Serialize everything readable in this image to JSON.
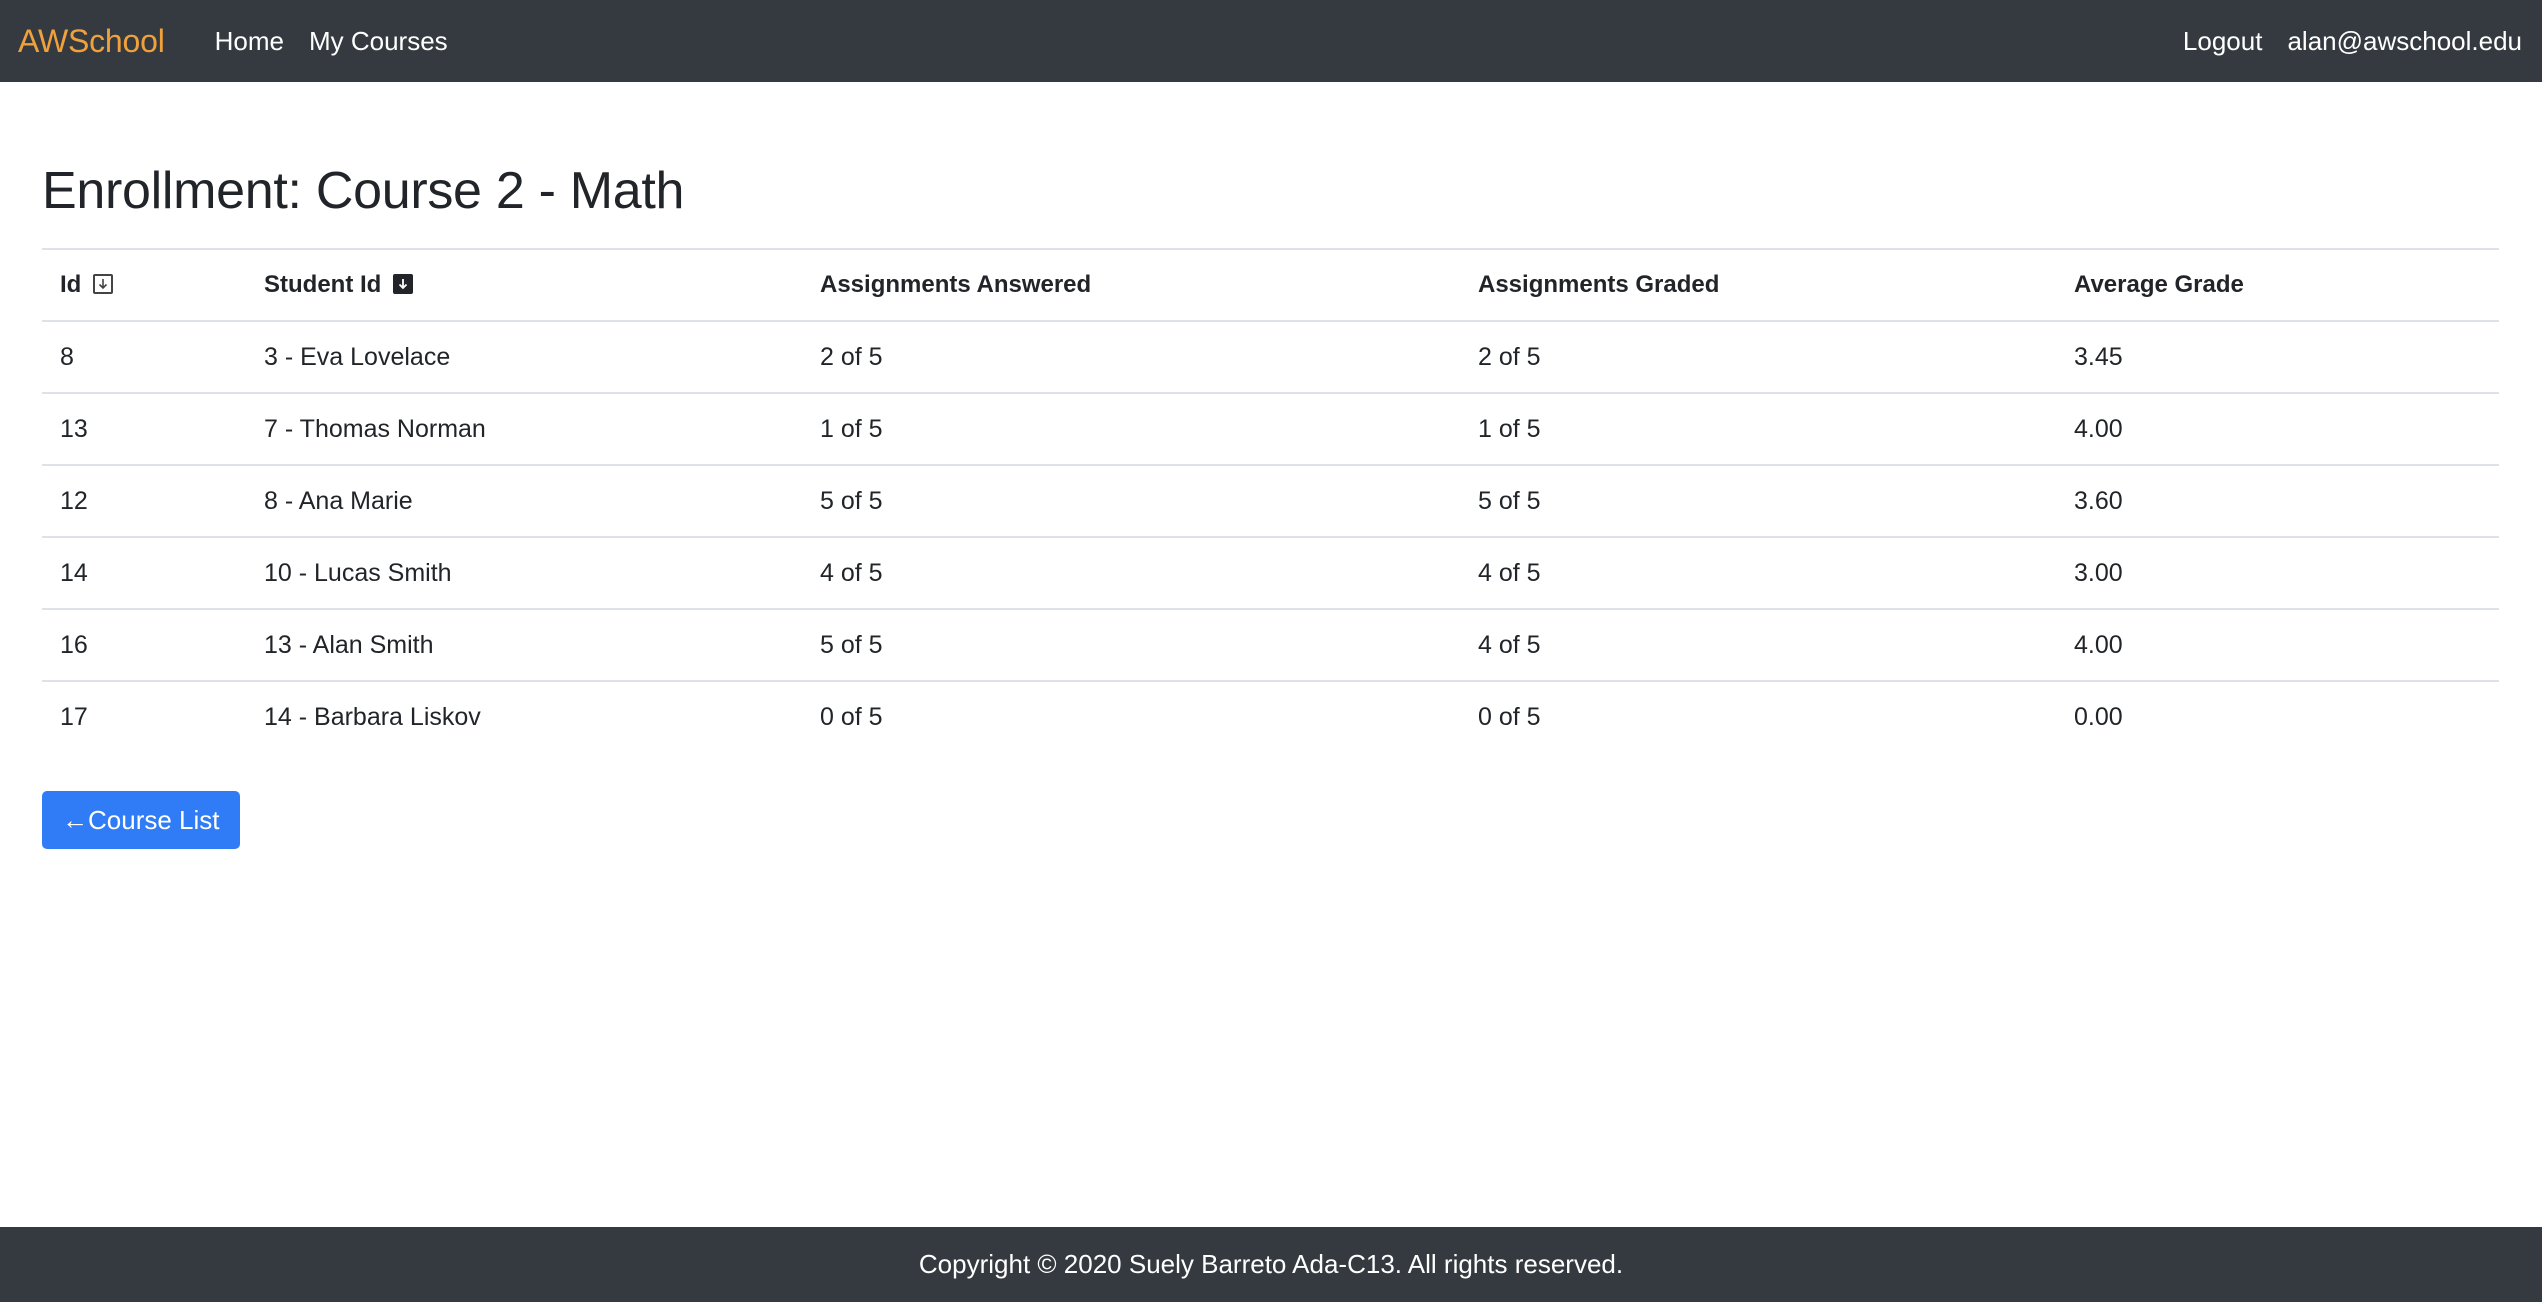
{
  "nav": {
    "brand": "AWSchool",
    "links": [
      "Home",
      "My Courses"
    ],
    "logout": "Logout",
    "user_email": "alan@awschool.edu"
  },
  "page": {
    "title": "Enrollment: Course 2 - Math"
  },
  "table": {
    "headers": [
      "Id",
      "Student Id",
      "Assignments Answered",
      "Assignments Graded",
      "Average Grade"
    ],
    "sort_icons": {
      "id": "sort-down-outline-icon",
      "student_id": "sort-down-filled-icon"
    },
    "rows": [
      [
        "8",
        "3 - Eva Lovelace",
        "2 of 5",
        "2 of 5",
        "3.45"
      ],
      [
        "13",
        "7 - Thomas Norman",
        "1 of 5",
        "1 of 5",
        "4.00"
      ],
      [
        "12",
        "8 - Ana Marie",
        "5 of 5",
        "5 of 5",
        "3.60"
      ],
      [
        "14",
        "10 - Lucas Smith",
        "4 of 5",
        "4 of 5",
        "3.00"
      ],
      [
        "16",
        "13 - Alan Smith",
        "5 of 5",
        "4 of 5",
        "4.00"
      ],
      [
        "17",
        "14 - Barbara Liskov",
        "0 of 5",
        "0 of 5",
        "0.00"
      ]
    ]
  },
  "back_button": {
    "label": "←Course List"
  },
  "footer": {
    "text": "Copyright © 2020 Suely Barreto Ada-C13. All rights reserved."
  },
  "colors": {
    "navbar_bg": "#343a40",
    "brand": "#f0a13c",
    "primary_button": "#2f7cf6"
  }
}
